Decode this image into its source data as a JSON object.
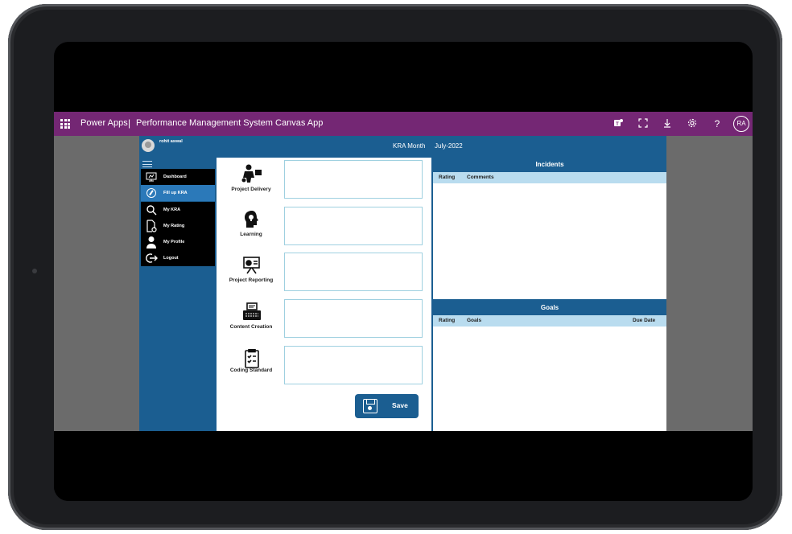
{
  "topbar": {
    "brand": "Power Apps",
    "separator": "|",
    "app_title": "Performance Management System Canvas App",
    "icons": [
      "teams-icon",
      "fit-screen-icon",
      "download-icon",
      "settings-icon",
      "help-icon"
    ],
    "user_initials": "RA"
  },
  "header": {
    "user_name": "rohit aswal",
    "kra_month_label": "KRA Month",
    "kra_month_value": "July-2022"
  },
  "nav": {
    "items": [
      {
        "label": "Dashboard",
        "icon": "dashboard-icon"
      },
      {
        "label": "Fill up KRA",
        "icon": "compass-icon",
        "active": true
      },
      {
        "label": "My KRA",
        "icon": "search-icon"
      },
      {
        "label": "My Rating",
        "icon": "document-icon"
      },
      {
        "label": "My Profile",
        "icon": "person-icon"
      },
      {
        "label": "Logout",
        "icon": "logout-icon"
      }
    ]
  },
  "kras": [
    {
      "name": "Project Delivery",
      "icon": "delivery-person-icon",
      "value": ""
    },
    {
      "name": "Learning",
      "icon": "head-bulb-icon",
      "value": ""
    },
    {
      "name": "Project Reporting",
      "icon": "presentation-icon",
      "value": ""
    },
    {
      "name": "Content Creation",
      "icon": "typewriter-icon",
      "value": ""
    },
    {
      "name": "Coding Standard",
      "icon": "checklist-icon",
      "value": ""
    }
  ],
  "save_label": "Save",
  "incidents": {
    "title": "Incidents",
    "columns": [
      "Rating",
      "Comments"
    ],
    "rows": []
  },
  "goals": {
    "title": "Goals",
    "columns": [
      "Rating",
      "Goals",
      "Due Date"
    ],
    "rows": []
  },
  "colors": {
    "topbar": "#742774",
    "app_blue": "#1b5e91",
    "nav_active": "#2b79b9",
    "column_header": "#b9dcef",
    "input_border": "#9fd0e0"
  }
}
